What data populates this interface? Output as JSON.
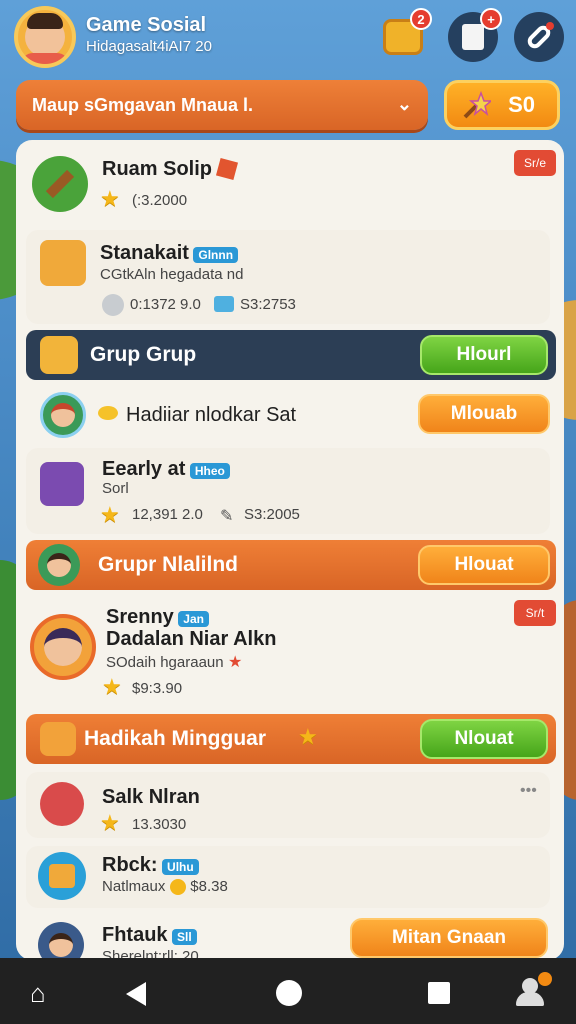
{
  "header": {
    "app_name": "Game Sosial",
    "app_sub": "Hidagasalt4iAI7 20",
    "badges": [
      "2",
      "+"
    ]
  },
  "dropdown": {
    "label": "Maup sGmgavan Mnaua l.",
    "chevron": "⌄"
  },
  "coin_button": {
    "label": "S0"
  },
  "item1": {
    "title": "Ruam Solip",
    "value": "(:3.2000",
    "tag": "Sr/e"
  },
  "item2": {
    "title": "Stanakait",
    "tag": "Glnnn",
    "sub": "CGtkAln hegadata nd",
    "stat1": "0:1372 9.0",
    "stat2": "S3:2753"
  },
  "section1": {
    "title": "Grup Grup",
    "button": "Hlourl"
  },
  "item3": {
    "title": "Hadiiar nlodkar Sat",
    "button": "Mlouab"
  },
  "item4": {
    "title": "Eearly at",
    "tag": "Hheo",
    "sub": "Sorl",
    "stat1": "12,391 2.0",
    "stat2": "S3:2005"
  },
  "section2": {
    "title": "Grupr Nlalilnd",
    "button": "Hlouat"
  },
  "item5": {
    "title1": "Srenny",
    "tag": "Jan",
    "title2": "Dadalan Niar Alkn",
    "sub": "SOdaih hgaraaun",
    "value": "$9:3.90",
    "redtag": "Sr/t"
  },
  "section3": {
    "title": "Hadikah Mingguar",
    "button": "Nlouat"
  },
  "item6": {
    "title": "Salk Nlran",
    "value": "13.3030",
    "dots": "•••"
  },
  "item7": {
    "title": "Rbck:",
    "tag": "Ulhu",
    "sub": "Natlmaux",
    "value": "$8.38"
  },
  "item8": {
    "title": "Fhtauk",
    "tag": "Sll",
    "sub": "Sherelnt:rll: 20",
    "button": "Mitan Gnaan"
  },
  "colors": {
    "accent_orange": "#e2712c",
    "accent_green": "#57b526",
    "section_navy": "#2c3e55",
    "star": "#f5b719"
  }
}
